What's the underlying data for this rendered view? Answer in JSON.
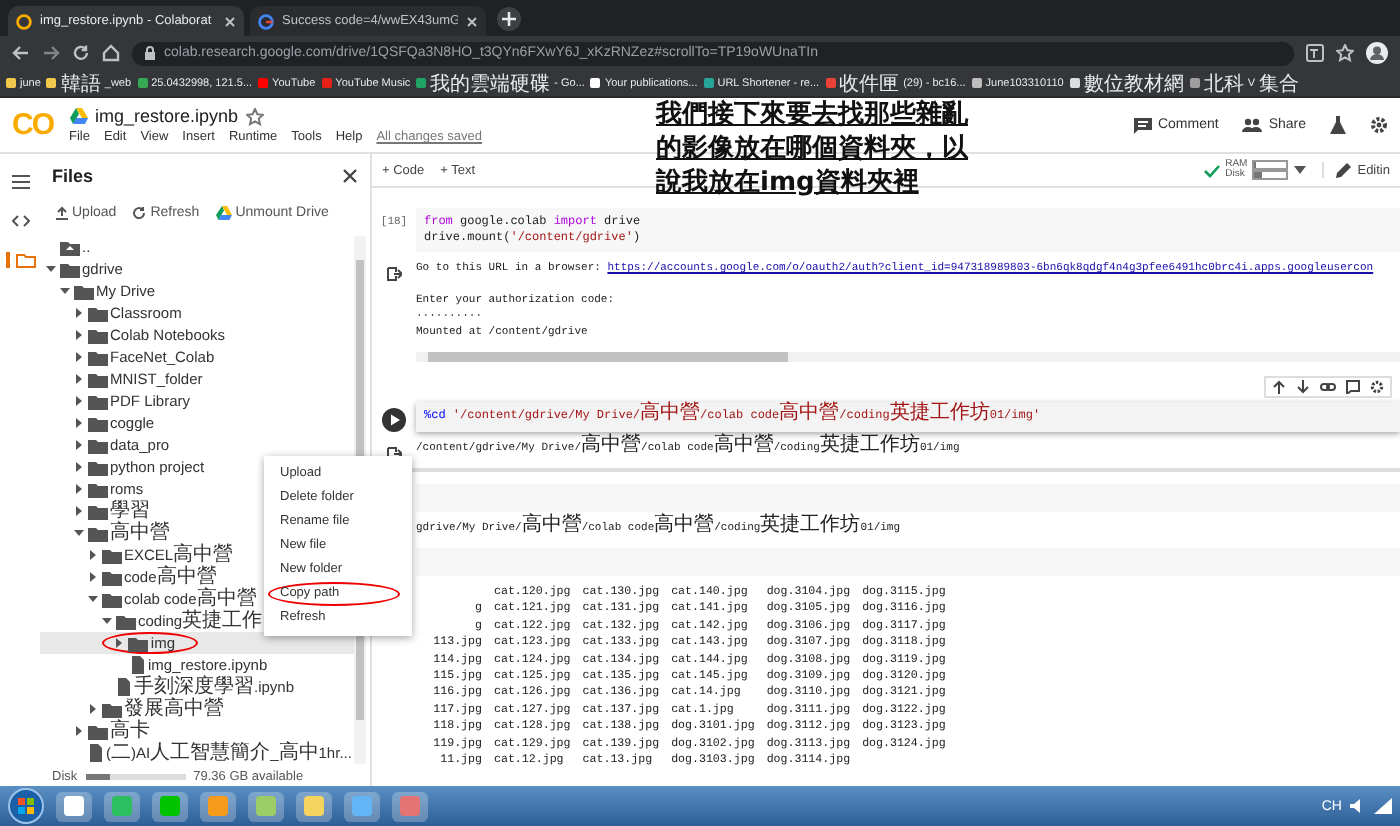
{
  "browser": {
    "tabs": [
      {
        "title": "img_restore.ipynb - Colaborat",
        "selected": true,
        "kind": "colab"
      },
      {
        "title": "Success code=4/wwEX43umG",
        "selected": false,
        "kind": "google"
      }
    ],
    "url": "colab.research.google.com/drive/1QSFQa3N8HO_t3QYn6FXwY6J_xKzRNZez#scrollTo=TP19oWUnaTIn",
    "bookmarks": [
      {
        "label": "june",
        "color": "#f2c94c"
      },
      {
        "label": "韓語_web",
        "color": "#f2c94c"
      },
      {
        "label": "25.0432998, 121.5...",
        "color": "#34a853"
      },
      {
        "label": "YouTube",
        "color": "#ff0000"
      },
      {
        "label": "YouTube Music",
        "color": "#e62117"
      },
      {
        "label": "我的雲端硬碟 - Go...",
        "color": "#1fa463"
      },
      {
        "label": "Your publications...",
        "color": "#ffffff"
      },
      {
        "label": "URL Shortener - re...",
        "color": "#26a69a"
      },
      {
        "label": "收件匣 (29) - bc16...",
        "color": "#ea4335"
      },
      {
        "label": "June103310110",
        "color": "#bdbdbd"
      },
      {
        "label": "數位教材網",
        "color": "#dadce0"
      },
      {
        "label": "北科V集合",
        "color": "#9e9e9e"
      }
    ]
  },
  "colab": {
    "logo": "CO",
    "title": "img_restore.ipynb",
    "menu": [
      "File",
      "Edit",
      "View",
      "Insert",
      "Runtime",
      "Tools",
      "Help"
    ],
    "save_status": "All changes saved",
    "actions": [
      "Comment",
      "Share"
    ]
  },
  "annotation": "我們接下來要去找那些雜亂的影像放在哪個資料夾，以說我放在img資料夾裡",
  "sidebar": {
    "title": "Files",
    "actions": [
      "Upload",
      "Refresh",
      "Unmount Drive"
    ],
    "tree": [
      {
        "name": "..",
        "kind": "parent",
        "selected": false
      },
      {
        "name": "gdrive",
        "kind": "folder",
        "expanded": true,
        "selected": false,
        "children": [
          {
            "name": "My Drive",
            "kind": "folder",
            "expanded": true,
            "selected": false,
            "children": [
              {
                "name": "Classroom",
                "kind": "folder",
                "expanded": false,
                "selected": false
              },
              {
                "name": "Colab Notebooks",
                "kind": "folder",
                "expanded": false,
                "selected": false
              },
              {
                "name": "FaceNet_Colab",
                "kind": "folder",
                "expanded": false,
                "selected": false
              },
              {
                "name": "MNIST_folder",
                "kind": "folder",
                "expanded": false,
                "selected": false
              },
              {
                "name": "PDF Library",
                "kind": "folder",
                "expanded": false,
                "selected": false
              },
              {
                "name": "coggle",
                "kind": "folder",
                "expanded": false,
                "selected": false
              },
              {
                "name": "data_pro",
                "kind": "folder",
                "expanded": false,
                "selected": false
              },
              {
                "name": "python project",
                "kind": "folder",
                "expanded": false,
                "selected": false
              },
              {
                "name": "roms",
                "kind": "folder",
                "expanded": false,
                "selected": false
              },
              {
                "name": "學習",
                "kind": "folder",
                "expanded": false,
                "selected": false
              },
              {
                "name": "高中營",
                "kind": "folder",
                "expanded": true,
                "selected": false,
                "children": [
                  {
                    "name": "EXCEL高中營",
                    "kind": "folder",
                    "expanded": false,
                    "selected": false
                  },
                  {
                    "name": "code高中營",
                    "kind": "folder",
                    "expanded": false,
                    "selected": false
                  },
                  {
                    "name": "colab code高中營",
                    "kind": "folder",
                    "expanded": true,
                    "selected": false,
                    "children": [
                      {
                        "name": "coding英捷工作",
                        "kind": "folder",
                        "expanded": true,
                        "selected": false,
                        "children": [
                          {
                            "name": "img",
                            "kind": "folder",
                            "expanded": false,
                            "selected": true,
                            "circled": true
                          },
                          {
                            "name": "img_restore.ipynb",
                            "kind": "file",
                            "selected": false
                          }
                        ]
                      },
                      {
                        "name": "手刻深度學習.ipynb",
                        "kind": "file",
                        "selected": false
                      }
                    ]
                  },
                  {
                    "name": "發展高中營",
                    "kind": "folder",
                    "expanded": false,
                    "selected": false
                  }
                ]
              },
              {
                "name": "高卡",
                "kind": "folder",
                "expanded": false,
                "selected": false
              },
              {
                "name": "(二)AI人工智慧簡介_高中1hr...",
                "kind": "file",
                "selected": false
              }
            ]
          }
        ]
      }
    ],
    "disk": {
      "label": "Disk",
      "level": 0.25,
      "available": "79.36 GB available"
    }
  },
  "toolbar": {
    "add": [
      "+ Code",
      "+ Text"
    ],
    "ram": {
      "label": "RAM",
      "level": 0.06
    },
    "disk": {
      "label": "Disk",
      "level": 0.25
    },
    "mode": "Editin"
  },
  "cells": [
    {
      "count": "[18]",
      "active": false,
      "code": [
        [
          {
            "text": "from",
            "kind": "keyword"
          },
          {
            "text": " google.colab "
          },
          {
            "text": "import",
            "kind": "keyword"
          },
          {
            "text": " drive"
          }
        ],
        [
          {
            "text": "drive.mount("
          },
          {
            "text": "'/content/gdrive'",
            "kind": "string"
          },
          {
            "text": ")"
          }
        ]
      ],
      "output": {
        "kind": "text",
        "h_scrollbar": true,
        "blocks": [
          [
            [
              {
                "text": "Go to this URL in a browser: "
              },
              {
                "text": "https://accounts.google.com/o/oauth2/auth?client_id=947318989803-6bn6qk8qdgf4n4g3pfee6491hc0brc4i.apps.googleusercon",
                "kind": "link"
              }
            ]
          ],
          [
            [
              {
                "text": "Enter your authorization code:"
              }
            ],
            [
              {
                "text": "··········"
              }
            ],
            [
              {
                "text": "Mounted at /content/gdrive"
              }
            ]
          ]
        ]
      }
    },
    {
      "active": true,
      "code": [
        [
          {
            "text": "%cd",
            "kind": "magic"
          },
          {
            "text": " '/content/gdrive/My Drive/高中營/colab code高中營/coding英捷工作坊01/img'",
            "kind": "string"
          }
        ]
      ],
      "output": {
        "kind": "text",
        "blocks": [
          [
            [
              {
                "text": "/content/gdrive/My Drive/高中營/colab code高中營/coding英捷工作坊01/img"
              }
            ]
          ]
        ]
      }
    },
    {
      "active": false,
      "output": {
        "kind": "text",
        "blocks": [
          [
            [
              {
                "text": "gdrive/My Drive/高中營/colab code高中營/coding英捷工作坊01/img"
              }
            ]
          ]
        ]
      }
    },
    {
      "active": false,
      "output": {
        "kind": "listing",
        "rows": [
          {
            "files": [
              "cat.120.jpg",
              "cat.130.jpg",
              "cat.140.jpg",
              "dog.3104.jpg",
              "dog.3115.jpg"
            ]
          },
          {
            "cut": "g",
            "files": [
              "cat.121.jpg",
              "cat.131.jpg",
              "cat.141.jpg",
              "dog.3105.jpg",
              "dog.3116.jpg"
            ]
          },
          {
            "cut": "g",
            "files": [
              "cat.122.jpg",
              "cat.132.jpg",
              "cat.142.jpg",
              "dog.3106.jpg",
              "dog.3117.jpg"
            ]
          },
          {
            "cut": "113.jpg",
            "files": [
              "cat.123.jpg",
              "cat.133.jpg",
              "cat.143.jpg",
              "dog.3107.jpg",
              "dog.3118.jpg"
            ]
          },
          {
            "cut": "114.jpg",
            "files": [
              "cat.124.jpg",
              "cat.134.jpg",
              "cat.144.jpg",
              "dog.3108.jpg",
              "dog.3119.jpg"
            ]
          },
          {
            "cut": "115.jpg",
            "files": [
              "cat.125.jpg",
              "cat.135.jpg",
              "cat.145.jpg",
              "dog.3109.jpg",
              "dog.3120.jpg"
            ]
          },
          {
            "cut": "116.jpg",
            "files": [
              "cat.126.jpg",
              "cat.136.jpg",
              "cat.14.jpg",
              "dog.3110.jpg",
              "dog.3121.jpg"
            ]
          },
          {
            "cut": "117.jpg",
            "files": [
              "cat.127.jpg",
              "cat.137.jpg",
              "cat.1.jpg",
              "dog.3111.jpg",
              "dog.3122.jpg"
            ]
          },
          {
            "cut": "118.jpg",
            "files": [
              "cat.128.jpg",
              "cat.138.jpg",
              "dog.3101.jpg",
              "dog.3112.jpg",
              "dog.3123.jpg"
            ]
          },
          {
            "cut": "119.jpg",
            "files": [
              "cat.129.jpg",
              "cat.139.jpg",
              "dog.3102.jpg",
              "dog.3113.jpg",
              "dog.3124.jpg"
            ]
          },
          {
            "cut": "11.jpg",
            "files": [
              "cat.12.jpg",
              "cat.13.jpg",
              "dog.3103.jpg",
              "dog.3114.jpg"
            ]
          }
        ]
      }
    }
  ],
  "context_menu": [
    {
      "label": "Upload",
      "circled": false
    },
    {
      "label": "Delete folder",
      "circled": false
    },
    {
      "label": "Rename file",
      "circled": false
    },
    {
      "label": "New file",
      "circled": false
    },
    {
      "label": "New folder",
      "circled": false
    },
    {
      "label": "Copy path",
      "circled": true
    },
    {
      "label": "Refresh",
      "circled": false
    }
  ],
  "taskbar": {
    "apps": [
      {
        "color": "#ffffff"
      },
      {
        "color": "#2dbe60"
      },
      {
        "color": "#00c300"
      },
      {
        "color": "#f89a1c"
      },
      {
        "color": "#9ccc65"
      },
      {
        "color": "#f4d35e"
      },
      {
        "color": "#64b5f6"
      },
      {
        "color": "#e57373"
      }
    ],
    "tray": "CH"
  }
}
